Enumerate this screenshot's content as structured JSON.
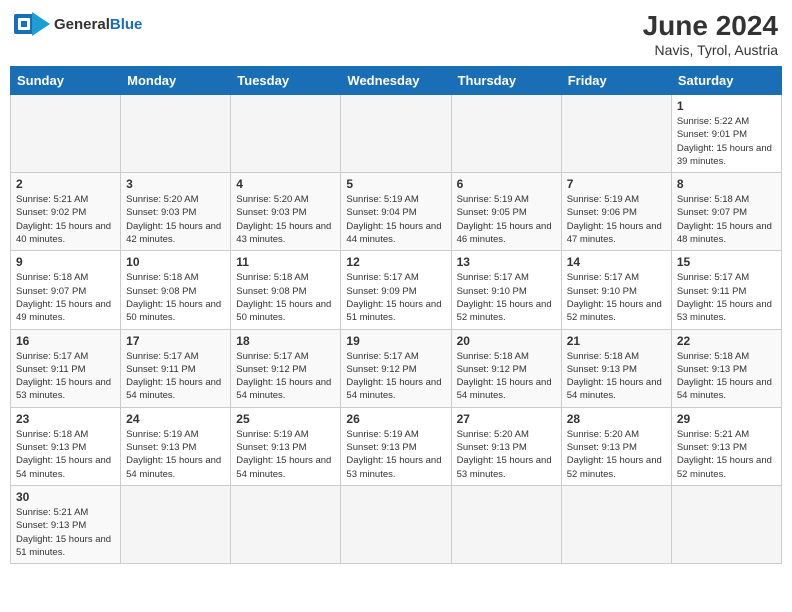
{
  "header": {
    "logo_general": "General",
    "logo_blue": "Blue",
    "month_year": "June 2024",
    "location": "Navis, Tyrol, Austria"
  },
  "days_of_week": [
    "Sunday",
    "Monday",
    "Tuesday",
    "Wednesday",
    "Thursday",
    "Friday",
    "Saturday"
  ],
  "weeks": [
    [
      {
        "day": "",
        "empty": true
      },
      {
        "day": "",
        "empty": true
      },
      {
        "day": "",
        "empty": true
      },
      {
        "day": "",
        "empty": true
      },
      {
        "day": "",
        "empty": true
      },
      {
        "day": "",
        "empty": true
      },
      {
        "day": "1",
        "sunrise": "5:22 AM",
        "sunset": "9:01 PM",
        "daylight": "15 hours and 39 minutes."
      }
    ],
    [
      {
        "day": "2",
        "sunrise": "5:21 AM",
        "sunset": "9:02 PM",
        "daylight": "15 hours and 40 minutes."
      },
      {
        "day": "3",
        "sunrise": "5:20 AM",
        "sunset": "9:03 PM",
        "daylight": "15 hours and 42 minutes."
      },
      {
        "day": "4",
        "sunrise": "5:20 AM",
        "sunset": "9:03 PM",
        "daylight": "15 hours and 43 minutes."
      },
      {
        "day": "5",
        "sunrise": "5:19 AM",
        "sunset": "9:04 PM",
        "daylight": "15 hours and 44 minutes."
      },
      {
        "day": "6",
        "sunrise": "5:19 AM",
        "sunset": "9:05 PM",
        "daylight": "15 hours and 46 minutes."
      },
      {
        "day": "7",
        "sunrise": "5:19 AM",
        "sunset": "9:06 PM",
        "daylight": "15 hours and 47 minutes."
      },
      {
        "day": "8",
        "sunrise": "5:18 AM",
        "sunset": "9:07 PM",
        "daylight": "15 hours and 48 minutes."
      }
    ],
    [
      {
        "day": "9",
        "sunrise": "5:18 AM",
        "sunset": "9:07 PM",
        "daylight": "15 hours and 49 minutes."
      },
      {
        "day": "10",
        "sunrise": "5:18 AM",
        "sunset": "9:08 PM",
        "daylight": "15 hours and 50 minutes."
      },
      {
        "day": "11",
        "sunrise": "5:18 AM",
        "sunset": "9:08 PM",
        "daylight": "15 hours and 50 minutes."
      },
      {
        "day": "12",
        "sunrise": "5:17 AM",
        "sunset": "9:09 PM",
        "daylight": "15 hours and 51 minutes."
      },
      {
        "day": "13",
        "sunrise": "5:17 AM",
        "sunset": "9:10 PM",
        "daylight": "15 hours and 52 minutes."
      },
      {
        "day": "14",
        "sunrise": "5:17 AM",
        "sunset": "9:10 PM",
        "daylight": "15 hours and 52 minutes."
      },
      {
        "day": "15",
        "sunrise": "5:17 AM",
        "sunset": "9:11 PM",
        "daylight": "15 hours and 53 minutes."
      }
    ],
    [
      {
        "day": "16",
        "sunrise": "5:17 AM",
        "sunset": "9:11 PM",
        "daylight": "15 hours and 53 minutes."
      },
      {
        "day": "17",
        "sunrise": "5:17 AM",
        "sunset": "9:11 PM",
        "daylight": "15 hours and 54 minutes."
      },
      {
        "day": "18",
        "sunrise": "5:17 AM",
        "sunset": "9:12 PM",
        "daylight": "15 hours and 54 minutes."
      },
      {
        "day": "19",
        "sunrise": "5:17 AM",
        "sunset": "9:12 PM",
        "daylight": "15 hours and 54 minutes."
      },
      {
        "day": "20",
        "sunrise": "5:18 AM",
        "sunset": "9:12 PM",
        "daylight": "15 hours and 54 minutes."
      },
      {
        "day": "21",
        "sunrise": "5:18 AM",
        "sunset": "9:13 PM",
        "daylight": "15 hours and 54 minutes."
      },
      {
        "day": "22",
        "sunrise": "5:18 AM",
        "sunset": "9:13 PM",
        "daylight": "15 hours and 54 minutes."
      }
    ],
    [
      {
        "day": "23",
        "sunrise": "5:18 AM",
        "sunset": "9:13 PM",
        "daylight": "15 hours and 54 minutes."
      },
      {
        "day": "24",
        "sunrise": "5:19 AM",
        "sunset": "9:13 PM",
        "daylight": "15 hours and 54 minutes."
      },
      {
        "day": "25",
        "sunrise": "5:19 AM",
        "sunset": "9:13 PM",
        "daylight": "15 hours and 54 minutes."
      },
      {
        "day": "26",
        "sunrise": "5:19 AM",
        "sunset": "9:13 PM",
        "daylight": "15 hours and 53 minutes."
      },
      {
        "day": "27",
        "sunrise": "5:20 AM",
        "sunset": "9:13 PM",
        "daylight": "15 hours and 53 minutes."
      },
      {
        "day": "28",
        "sunrise": "5:20 AM",
        "sunset": "9:13 PM",
        "daylight": "15 hours and 52 minutes."
      },
      {
        "day": "29",
        "sunrise": "5:21 AM",
        "sunset": "9:13 PM",
        "daylight": "15 hours and 52 minutes."
      }
    ],
    [
      {
        "day": "30",
        "sunrise": "5:21 AM",
        "sunset": "9:13 PM",
        "daylight": "15 hours and 51 minutes."
      },
      {
        "day": "",
        "empty": true
      },
      {
        "day": "",
        "empty": true
      },
      {
        "day": "",
        "empty": true
      },
      {
        "day": "",
        "empty": true
      },
      {
        "day": "",
        "empty": true
      },
      {
        "day": "",
        "empty": true
      }
    ]
  ]
}
